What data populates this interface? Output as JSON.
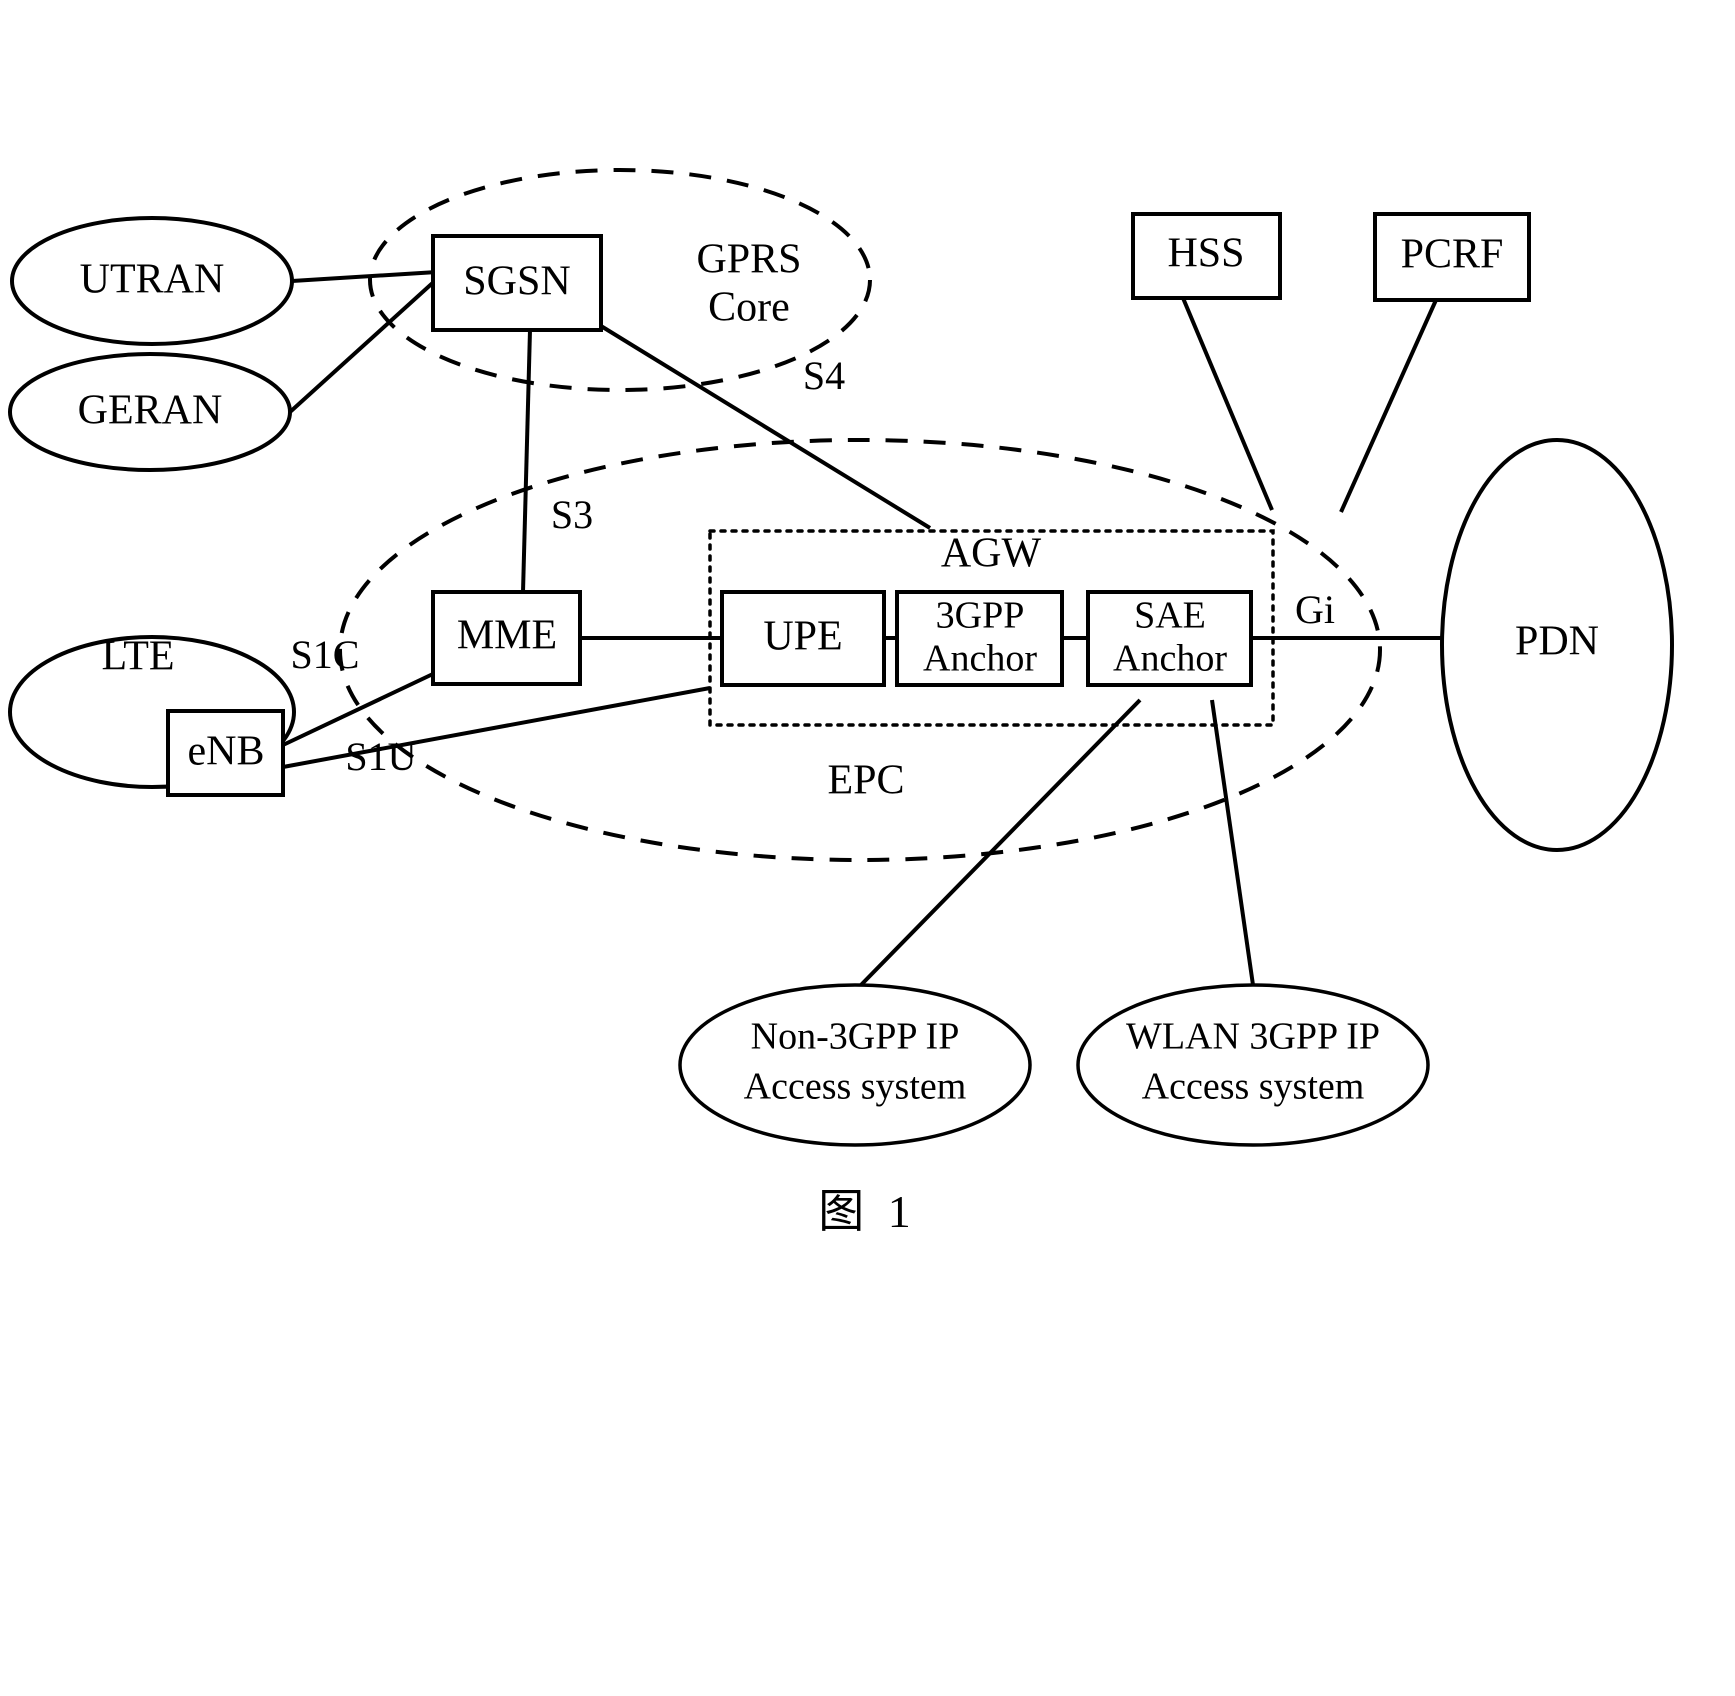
{
  "figure": {
    "caption": "图 1",
    "type": "network-architecture-diagram"
  },
  "groups": [
    {
      "id": "gprs-core",
      "label_line1": "GPRS",
      "label_line2": "Core",
      "shape": "dashed-ellipse"
    },
    {
      "id": "epc",
      "label": "EPC",
      "shape": "dashed-ellipse"
    },
    {
      "id": "agw",
      "label": "AGW",
      "shape": "dotted-rect"
    }
  ],
  "nodes": {
    "utran": {
      "label": "UTRAN",
      "shape": "ellipse"
    },
    "geran": {
      "label": "GERAN",
      "shape": "ellipse"
    },
    "sgsn": {
      "label": "SGSN",
      "shape": "rect"
    },
    "hss": {
      "label": "HSS",
      "shape": "rect"
    },
    "pcrf": {
      "label": "PCRF",
      "shape": "rect"
    },
    "lte": {
      "label": "LTE",
      "shape": "ellipse"
    },
    "enb": {
      "label": "eNB",
      "shape": "rect"
    },
    "mme": {
      "label": "MME",
      "shape": "rect"
    },
    "upe": {
      "label": "UPE",
      "shape": "rect"
    },
    "gpp_anchor": {
      "label_line1": "3GPP",
      "label_line2": "Anchor",
      "shape": "rect"
    },
    "sae_anchor": {
      "label_line1": "SAE",
      "label_line2": "Anchor",
      "shape": "rect"
    },
    "pdn": {
      "label": "PDN",
      "shape": "ellipse"
    },
    "non3gpp": {
      "label_line1": "Non-3GPP IP",
      "label_line2": "Access system",
      "shape": "ellipse"
    },
    "wlan3gpp": {
      "label_line1": "WLAN 3GPP IP",
      "label_line2": "Access system",
      "shape": "ellipse"
    }
  },
  "interfaces": [
    {
      "id": "s3",
      "label": "S3",
      "between": [
        "sgsn",
        "mme"
      ]
    },
    {
      "id": "s4",
      "label": "S4",
      "between": [
        "sgsn",
        "agw"
      ]
    },
    {
      "id": "s1c",
      "label": "S1C",
      "between": [
        "enb",
        "mme"
      ]
    },
    {
      "id": "s1u",
      "label": "S1U",
      "between": [
        "enb",
        "upe"
      ]
    },
    {
      "id": "gi",
      "label": "Gi",
      "between": [
        "sae_anchor",
        "pdn"
      ]
    }
  ],
  "links": [
    {
      "from": "utran",
      "to": "sgsn"
    },
    {
      "from": "geran",
      "to": "sgsn"
    },
    {
      "from": "sgsn",
      "to": "mme"
    },
    {
      "from": "sgsn",
      "to": "agw"
    },
    {
      "from": "hss",
      "to": "epc"
    },
    {
      "from": "pcrf",
      "to": "epc"
    },
    {
      "from": "enb",
      "to": "mme"
    },
    {
      "from": "enb",
      "to": "upe"
    },
    {
      "from": "mme",
      "to": "agw"
    },
    {
      "from": "upe",
      "to": "gpp_anchor"
    },
    {
      "from": "gpp_anchor",
      "to": "sae_anchor"
    },
    {
      "from": "sae_anchor",
      "to": "pdn"
    },
    {
      "from": "sae_anchor",
      "to": "non3gpp"
    },
    {
      "from": "sae_anchor",
      "to": "wlan3gpp"
    }
  ],
  "colors": {
    "stroke": "#000000",
    "fill": "#ffffff"
  }
}
